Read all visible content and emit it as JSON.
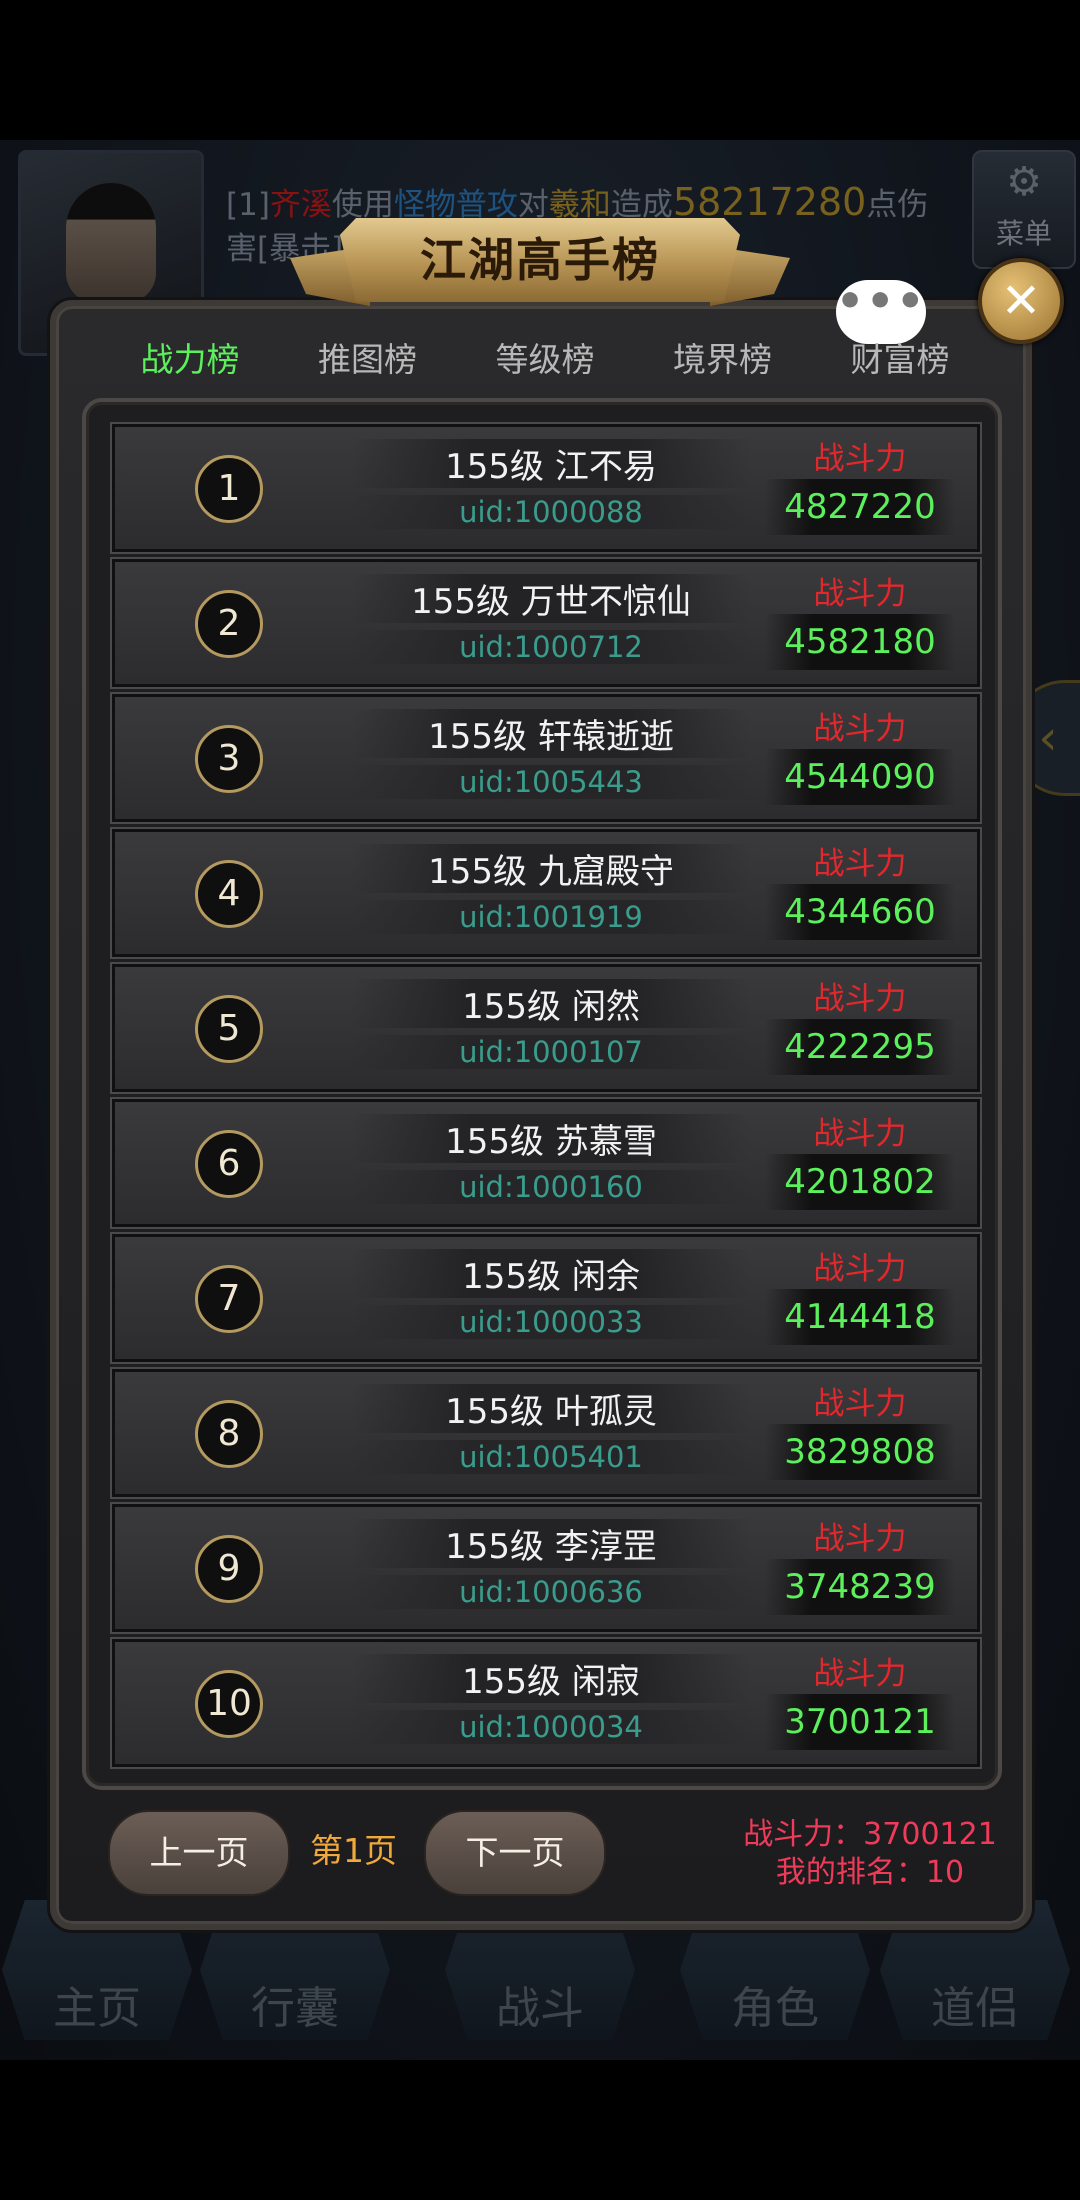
{
  "background": {
    "combat_log": {
      "prefix": "[1]",
      "actor": "齐溪",
      "verb": "使用",
      "skill": "怪物普攻",
      "to": "对",
      "target": "羲和",
      "dealt": "造成",
      "damage": "58217280",
      "suffix": "点伤害[暴击]"
    },
    "menu_label": "菜单",
    "nav": [
      "主页",
      "行囊",
      "战斗",
      "角色",
      "道侣"
    ]
  },
  "dialog": {
    "title": "江湖高手榜",
    "tabs": [
      {
        "label": "战力榜",
        "active": true
      },
      {
        "label": "推图榜",
        "active": false
      },
      {
        "label": "等级榜",
        "active": false
      },
      {
        "label": "境界榜",
        "active": false
      },
      {
        "label": "财富榜",
        "active": false
      }
    ],
    "power_label": "战斗力",
    "rows": [
      {
        "rank": "1",
        "name": "155级 江不易",
        "uid": "uid:1000088",
        "power": "4827220"
      },
      {
        "rank": "2",
        "name": "155级 万世不惊仙",
        "uid": "uid:1000712",
        "power": "4582180"
      },
      {
        "rank": "3",
        "name": "155级 轩辕逝逝",
        "uid": "uid:1005443",
        "power": "4544090"
      },
      {
        "rank": "4",
        "name": "155级 九窟殿守",
        "uid": "uid:1001919",
        "power": "4344660"
      },
      {
        "rank": "5",
        "name": "155级 闲然",
        "uid": "uid:1000107",
        "power": "4222295"
      },
      {
        "rank": "6",
        "name": "155级 苏慕雪",
        "uid": "uid:1000160",
        "power": "4201802"
      },
      {
        "rank": "7",
        "name": "155级 闲余",
        "uid": "uid:1000033",
        "power": "4144418"
      },
      {
        "rank": "8",
        "name": "155级 叶孤灵",
        "uid": "uid:1005401",
        "power": "3829808"
      },
      {
        "rank": "9",
        "name": "155级 李淳罡",
        "uid": "uid:1000636",
        "power": "3748239"
      },
      {
        "rank": "10",
        "name": "155级 闲寂",
        "uid": "uid:1000034",
        "power": "3700121"
      }
    ],
    "pager": {
      "prev": "上一页",
      "page": "第1页",
      "next": "下一页"
    },
    "my_power": "战斗力：3700121",
    "my_rank": "我的排名：10"
  }
}
